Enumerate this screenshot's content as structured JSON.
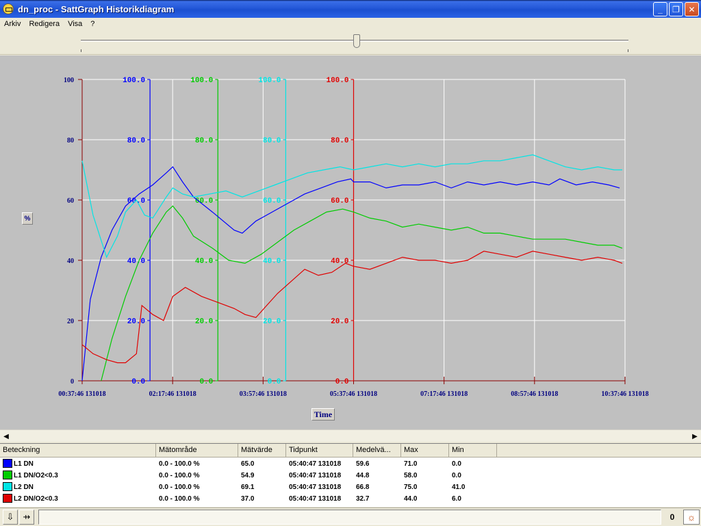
{
  "window": {
    "title": "dn_proc - SattGraph Historikdiagram",
    "buttons": {
      "minimize": "_",
      "maximize": "❐",
      "close": "✕"
    }
  },
  "menu": [
    "Arkiv",
    "Redigera",
    "Visa",
    "?"
  ],
  "graph": {
    "unit_button": "%",
    "time_button": "Time",
    "colors": {
      "blue": "#0000ff",
      "green": "#00cc00",
      "cyan": "#00e5e5",
      "red": "#e00000",
      "dark_red": "#8b0000",
      "navy": "#000080"
    }
  },
  "chart_data": {
    "type": "line",
    "title": "",
    "xlabel": "Time",
    "ylabel": "%",
    "x_ticks": [
      "00:37:46 131018",
      "02:17:46 131018",
      "03:57:46 131018",
      "05:37:46 131018",
      "07:17:46 131018",
      "08:57:46 131018",
      "10:37:46 131018"
    ],
    "x_tick_hours": [
      0,
      1.6667,
      3.3333,
      5,
      6.6667,
      8.3333,
      10
    ],
    "xlim_hours": [
      0,
      10
    ],
    "ylim": [
      0,
      100
    ],
    "primary_y_ticks": [
      "0",
      "20",
      "40",
      "60",
      "80",
      "100"
    ],
    "axes": [
      {
        "color": "#0000ff",
        "at_hours": 1.25,
        "ticks": [
          "0.0",
          "20.0",
          "40.0",
          "60.0",
          "80.0",
          "100.0"
        ]
      },
      {
        "color": "#00cc00",
        "at_hours": 2.5,
        "ticks": [
          "0.0",
          "20.0",
          "40.0",
          "60.0",
          "80.0",
          "100.0"
        ]
      },
      {
        "color": "#00e5e5",
        "at_hours": 3.75,
        "ticks": [
          "0.0",
          "20.0",
          "40.0",
          "60.0",
          "80.0",
          "100.0"
        ]
      },
      {
        "color": "#e00000",
        "at_hours": 5,
        "ticks": [
          "0.0",
          "20.0",
          "40.0",
          "60.0",
          "80.0",
          "100.0"
        ]
      }
    ],
    "series": [
      {
        "name": "L1 DN",
        "color": "#0000ff",
        "x": [
          0.0,
          0.15,
          0.35,
          0.55,
          0.8,
          1.05,
          1.3,
          1.55,
          1.67,
          1.85,
          2.05,
          2.4,
          2.8,
          2.95,
          3.2,
          3.5,
          3.8,
          4.1,
          4.4,
          4.7,
          4.95,
          5.0,
          5.3,
          5.6,
          5.9,
          6.2,
          6.5,
          6.8,
          7.1,
          7.4,
          7.7,
          8.0,
          8.3,
          8.6,
          8.8,
          9.1,
          9.4,
          9.7,
          9.9
        ],
        "y": [
          0,
          27,
          41,
          50,
          58,
          62,
          65,
          69,
          71,
          66,
          61,
          56,
          50,
          49,
          53,
          56,
          59,
          62,
          64,
          66,
          67,
          66,
          66,
          64,
          65,
          65,
          66,
          64,
          66,
          65,
          66,
          65,
          66,
          65,
          67,
          65,
          66,
          65,
          64
        ]
      },
      {
        "name": "L1 DN/O2<0.3",
        "color": "#00cc00",
        "x": [
          0.35,
          0.55,
          0.8,
          1.05,
          1.3,
          1.55,
          1.67,
          1.85,
          2.05,
          2.4,
          2.7,
          3.0,
          3.3,
          3.6,
          3.9,
          4.2,
          4.5,
          4.8,
          5.0,
          5.3,
          5.6,
          5.9,
          6.2,
          6.5,
          6.8,
          7.1,
          7.4,
          7.7,
          8.0,
          8.3,
          8.6,
          8.9,
          9.2,
          9.5,
          9.8,
          9.95
        ],
        "y": [
          0,
          14,
          28,
          40,
          49,
          56,
          58,
          54,
          48,
          44,
          40,
          39,
          42,
          46,
          50,
          53,
          56,
          57,
          56,
          54,
          53,
          51,
          52,
          51,
          50,
          51,
          49,
          49,
          48,
          47,
          47,
          47,
          46,
          45,
          45,
          44
        ]
      },
      {
        "name": "L2 DN",
        "color": "#00e5e5",
        "x": [
          0.0,
          0.2,
          0.45,
          0.65,
          0.8,
          1.0,
          1.15,
          1.3,
          1.55,
          1.67,
          1.85,
          2.05,
          2.35,
          2.65,
          2.95,
          3.25,
          3.55,
          3.85,
          4.15,
          4.45,
          4.75,
          5.0,
          5.3,
          5.6,
          5.9,
          6.2,
          6.5,
          6.8,
          7.1,
          7.4,
          7.7,
          8.0,
          8.3,
          8.6,
          8.9,
          9.2,
          9.5,
          9.8,
          9.95
        ],
        "y": [
          73,
          55,
          41,
          48,
          56,
          60,
          55,
          54,
          61,
          64,
          62,
          61,
          62,
          63,
          61,
          63,
          65,
          67,
          69,
          70,
          71,
          70,
          71,
          72,
          71,
          72,
          71,
          72,
          72,
          73,
          73,
          74,
          75,
          73,
          71,
          70,
          71,
          70,
          70
        ]
      },
      {
        "name": "L2 DN/O2<0.3",
        "color": "#e00000",
        "x": [
          0.0,
          0.2,
          0.45,
          0.65,
          0.8,
          1.0,
          1.1,
          1.3,
          1.5,
          1.67,
          1.9,
          2.2,
          2.5,
          2.8,
          3.0,
          3.2,
          3.4,
          3.6,
          3.85,
          4.1,
          4.35,
          4.6,
          4.85,
          5.0,
          5.3,
          5.6,
          5.9,
          6.2,
          6.5,
          6.8,
          7.1,
          7.4,
          7.7,
          8.0,
          8.3,
          8.6,
          8.9,
          9.2,
          9.5,
          9.8,
          9.95
        ],
        "y": [
          12,
          9,
          7,
          6,
          6,
          9,
          25,
          22,
          20,
          28,
          31,
          28,
          26,
          24,
          22,
          21,
          25,
          29,
          33,
          37,
          35,
          36,
          39,
          38,
          37,
          39,
          41,
          40,
          40,
          39,
          40,
          43,
          42,
          41,
          43,
          42,
          41,
          40,
          41,
          40,
          39
        ]
      }
    ]
  },
  "table": {
    "headers": [
      "Beteckning",
      "Mätområde",
      "Mätvärde",
      "Tidpunkt",
      "Medelvä...",
      "Max",
      "Min",
      ""
    ],
    "rows": [
      {
        "color": "#0000ff",
        "cells": [
          "L1 DN",
          "0.0 - 100.0 %",
          "65.0",
          "05:40:47 131018",
          "59.6",
          "71.0",
          "0.0"
        ]
      },
      {
        "color": "#00cc00",
        "cells": [
          "L1 DN/O2<0.3",
          "0.0 - 100.0 %",
          "54.9",
          "05:40:47 131018",
          "44.8",
          "58.0",
          "0.0"
        ]
      },
      {
        "color": "#00e5e5",
        "cells": [
          "L2 DN",
          "0.0 - 100.0 %",
          "69.1",
          "05:40:47 131018",
          "66.8",
          "75.0",
          "41.0"
        ]
      },
      {
        "color": "#e00000",
        "cells": [
          "L2 DN/O2<0.3",
          "0.0 - 100.0 %",
          "37.0",
          "05:40:47 131018",
          "32.7",
          "44.0",
          "6.0"
        ]
      }
    ]
  },
  "statusbar": {
    "count": "0"
  }
}
